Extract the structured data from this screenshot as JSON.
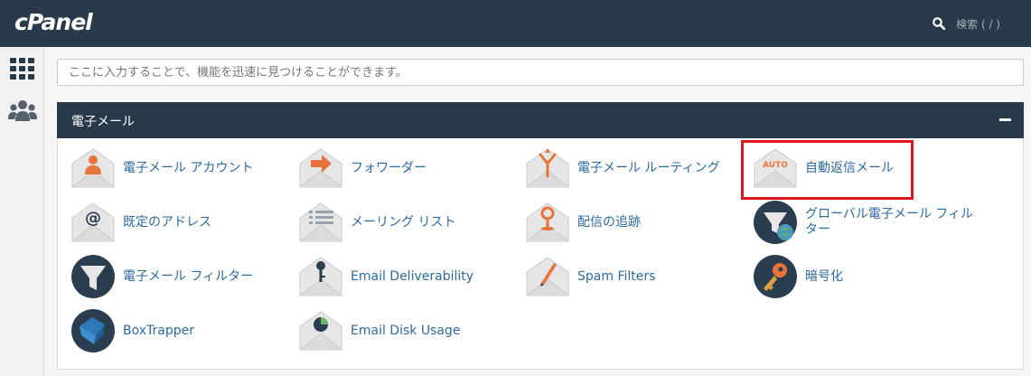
{
  "header": {
    "logo_text": "cPanel",
    "search_label": "検索 ( / )"
  },
  "sidebar": {
    "items": [
      {
        "icon": "grid-icon"
      },
      {
        "icon": "users-icon"
      }
    ]
  },
  "search": {
    "placeholder": "ここに入力することで、機能を迅速に見つけることができます。"
  },
  "panel": {
    "title": "電子メール",
    "collapse_icon": "minus-icon",
    "items": [
      {
        "label": "電子メール アカウント",
        "icon": "email-account-icon"
      },
      {
        "label": "フォワーダー",
        "icon": "forwarder-icon"
      },
      {
        "label": "電子メール ルーティング",
        "icon": "email-routing-icon"
      },
      {
        "label": "自動返信メール",
        "icon": "autoresponder-icon"
      },
      {
        "label": "既定のアドレス",
        "icon": "default-address-icon"
      },
      {
        "label": "メーリング リスト",
        "icon": "mailing-list-icon"
      },
      {
        "label": "配信の追跡",
        "icon": "delivery-tracking-icon"
      },
      {
        "label": "グローバル電子メール フィルター",
        "icon": "global-filter-icon"
      },
      {
        "label": "電子メール フィルター",
        "icon": "email-filter-icon"
      },
      {
        "label": "Email Deliverability",
        "icon": "email-deliverability-icon"
      },
      {
        "label": "Spam Filters",
        "icon": "spam-filters-icon"
      },
      {
        "label": "暗号化",
        "icon": "encryption-icon"
      },
      {
        "label": "BoxTrapper",
        "icon": "boxtrapper-icon"
      },
      {
        "label": "Email Disk Usage",
        "icon": "email-disk-usage-icon"
      }
    ]
  },
  "highlight_color": "#e0141c",
  "colors": {
    "header_bg": "#293a4a",
    "link": "#2b6aa0"
  }
}
